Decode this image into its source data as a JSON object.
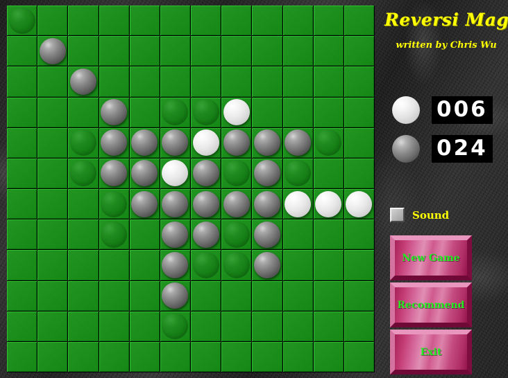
{
  "window": {
    "title": "Reversi Magic"
  },
  "panel": {
    "title": "Reversi Magic",
    "subtitle": "written by Chris Wu",
    "colors": {
      "title_text": "#ffff00",
      "button_text": "#22ee22",
      "button_face": "#d4659a",
      "board_green": "#149014",
      "score_bg": "#000000",
      "score_text": "#ffffff"
    },
    "scores": [
      {
        "id": "white",
        "piece": "white-disc-icon",
        "value": "006"
      },
      {
        "id": "dark",
        "piece": "dark-disc-icon",
        "value": "024"
      }
    ],
    "sound": {
      "label": "Sound",
      "checked": false
    },
    "buttons": [
      {
        "id": "new-game",
        "label": "New Game"
      },
      {
        "id": "recommend",
        "label": "Recommend"
      },
      {
        "id": "exit",
        "label": "Exit"
      }
    ]
  },
  "board": {
    "columns": 12,
    "rows": 12,
    "legend": {
      "0": "empty",
      "D": "dark-piece",
      "W": "white-piece",
      "G": "hint-ghost-piece"
    },
    "white_count": 6,
    "dark_count": 24,
    "grid": [
      [
        "G",
        "0",
        "0",
        "0",
        "0",
        "0",
        "0",
        "0",
        "0",
        "0",
        "0",
        "0"
      ],
      [
        "0",
        "D",
        "0",
        "0",
        "0",
        "0",
        "0",
        "0",
        "0",
        "0",
        "0",
        "0"
      ],
      [
        "0",
        "0",
        "D",
        "0",
        "0",
        "0",
        "0",
        "0",
        "0",
        "0",
        "0",
        "0"
      ],
      [
        "0",
        "0",
        "0",
        "D",
        "0",
        "G",
        "G",
        "W",
        "0",
        "0",
        "0",
        "0"
      ],
      [
        "0",
        "0",
        "G",
        "D",
        "D",
        "D",
        "W",
        "D",
        "D",
        "D",
        "G",
        "0"
      ],
      [
        "0",
        "0",
        "G",
        "D",
        "D",
        "W",
        "D",
        "G",
        "D",
        "G",
        "0",
        "0"
      ],
      [
        "0",
        "0",
        "0",
        "G",
        "D",
        "D",
        "D",
        "D",
        "D",
        "W",
        "W",
        "W"
      ],
      [
        "0",
        "0",
        "0",
        "G",
        "0",
        "D",
        "D",
        "G",
        "D",
        "0",
        "0",
        "0"
      ],
      [
        "0",
        "0",
        "0",
        "0",
        "0",
        "D",
        "G",
        "G",
        "D",
        "0",
        "0",
        "0"
      ],
      [
        "0",
        "0",
        "0",
        "0",
        "0",
        "D",
        "0",
        "0",
        "0",
        "0",
        "0",
        "0"
      ],
      [
        "0",
        "0",
        "0",
        "0",
        "0",
        "G",
        "0",
        "0",
        "0",
        "0",
        "0",
        "0"
      ],
      [
        "0",
        "0",
        "0",
        "0",
        "0",
        "0",
        "0",
        "0",
        "0",
        "0",
        "0",
        "0"
      ]
    ]
  }
}
